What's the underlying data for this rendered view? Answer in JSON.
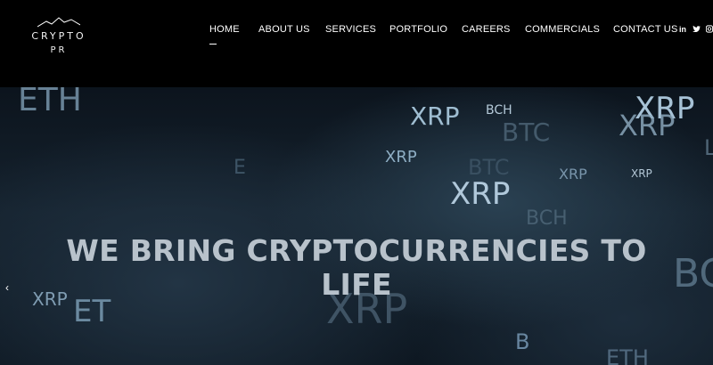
{
  "logo": {
    "line1": "CRYPTO",
    "line2": "PR",
    "icon": "chart-line-icon"
  },
  "nav": {
    "items": [
      {
        "label": "HOME",
        "active": true
      },
      {
        "label": "ABOUT US"
      },
      {
        "label": "SERVICES"
      },
      {
        "label": "PORTFOLIO"
      },
      {
        "label": "CAREERS"
      },
      {
        "label": "COMMERCIALS"
      },
      {
        "label": "CONTACT US"
      }
    ]
  },
  "social": {
    "linkedin": "in",
    "twitter": "twitter-icon",
    "instagram": "instagram-icon"
  },
  "hero": {
    "title_line1": "WE BRING CRYPTOCURRENCIES TO",
    "title_line2": "LIFE",
    "prev_arrow": "‹",
    "bg_words": [
      "ETH",
      "XRP",
      "BTC",
      "XRP",
      "XRP",
      "BCH",
      "BTC",
      "XRP",
      "XRP",
      "XRP",
      "BCH",
      "XRP",
      "ET",
      "XRP",
      "XRP",
      "BC",
      "B",
      "ETH",
      "L",
      "E"
    ]
  },
  "colors": {
    "header_bg": "#000000",
    "hero_bg": "#15222e",
    "title": "#b8c2cb",
    "nav_text": "#ffffff"
  }
}
